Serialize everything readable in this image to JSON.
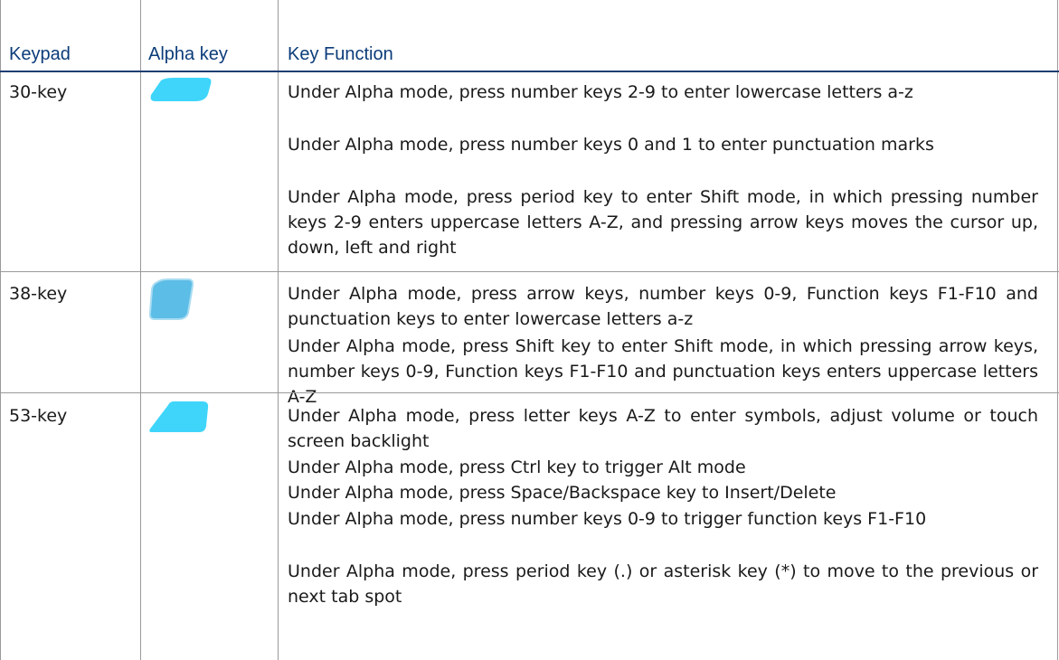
{
  "table": {
    "headers": {
      "keypad": "Keypad",
      "alpha_key": "Alpha key",
      "key_function": "Key Function"
    },
    "rows": [
      {
        "keypad": "30-key",
        "alpha_key_icon": "alpha-key-30-icon",
        "alpha_key_color": "#3fd5fa",
        "functions": [
          "Under Alpha mode, press number keys 2-9 to enter lowercase letters a-z",
          "Under Alpha mode, press number keys 0 and 1 to enter punctuation marks",
          "Under Alpha mode, press period key to enter Shift mode, in which pressing number keys 2-9 enters uppercase letters A-Z, and pressing arrow keys moves the cursor up, down, left and right"
        ]
      },
      {
        "keypad": "38-key",
        "alpha_key_icon": "alpha-key-38-icon",
        "alpha_key_color": "#5cbde6",
        "functions": [
          "Under Alpha mode, press arrow keys, number keys 0-9, Function keys F1-F10 and punctuation keys to enter lowercase letters a-z",
          "Under Alpha mode, press Shift key to enter Shift mode, in which pressing arrow keys, number keys 0-9, Function keys F1-F10 and punctuation keys enters uppercase letters A-Z"
        ]
      },
      {
        "keypad": "53-key",
        "alpha_key_icon": "alpha-key-53-icon",
        "alpha_key_color": "#3fd5fa",
        "functions": [
          "Under Alpha mode, press letter keys A-Z to enter symbols, adjust volume or touch screen backlight",
          "Under Alpha mode, press Ctrl key to trigger Alt mode",
          "Under Alpha mode, press Space/Backspace key to Insert/Delete",
          "Under Alpha mode, press number keys 0-9 to trigger function keys F1-F10",
          "Under Alpha mode, press period key (.) or asterisk key (*) to move to the previous or next tab spot"
        ]
      }
    ]
  }
}
